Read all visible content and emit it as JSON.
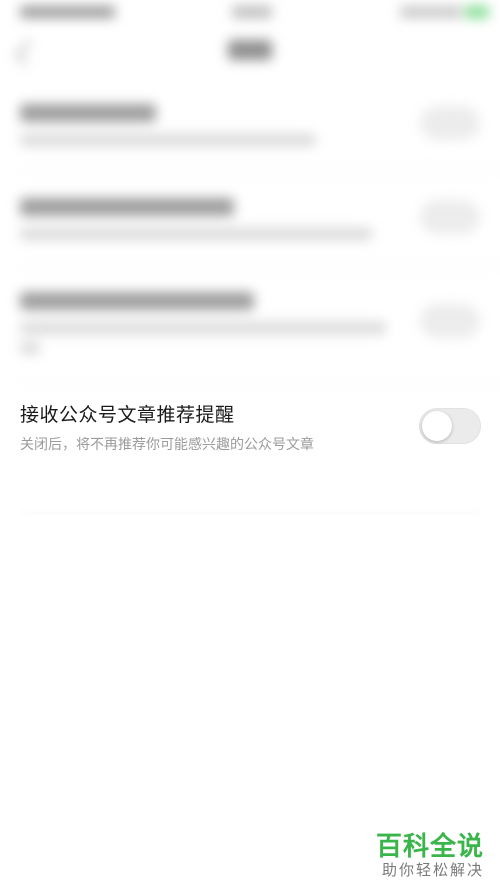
{
  "setting": {
    "title": "接收公众号文章推荐提醒",
    "description": "关闭后，将不再推荐你可能感兴趣的公众号文章",
    "enabled": false
  },
  "watermark": {
    "main": "百科全说",
    "sub": "助你轻松解决"
  },
  "colors": {
    "watermark_green": "#39b54a",
    "toggle_off": "#ebebeb",
    "title_text": "#1a1a1a",
    "desc_text": "#9b9b9b"
  },
  "icons": {
    "back": "chevron-left-icon"
  }
}
